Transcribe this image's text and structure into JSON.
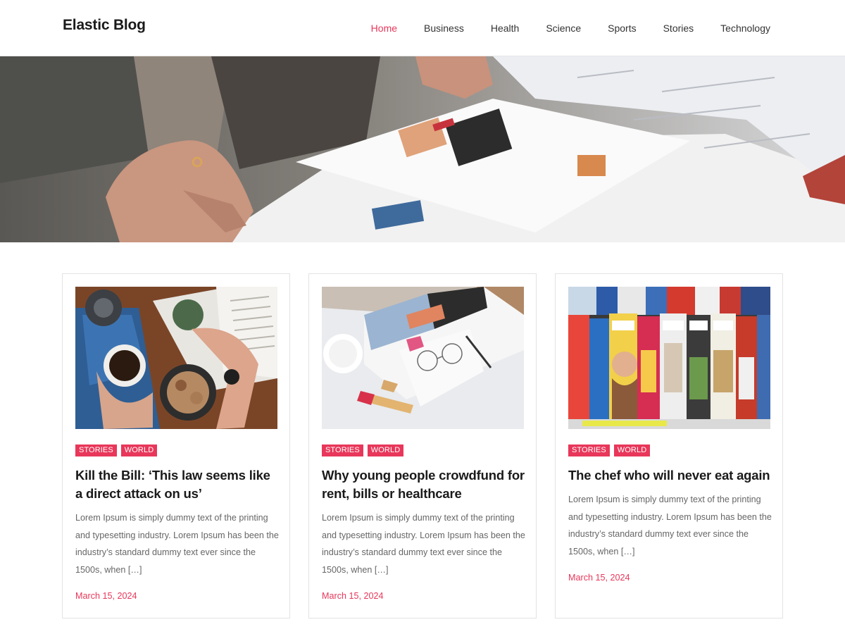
{
  "site": {
    "title": "Elastic Blog"
  },
  "nav": {
    "items": [
      {
        "label": "Home",
        "active": true
      },
      {
        "label": "Business"
      },
      {
        "label": "Health"
      },
      {
        "label": "Science"
      },
      {
        "label": "Sports"
      },
      {
        "label": "Stories"
      },
      {
        "label": "Technology"
      }
    ]
  },
  "hero": {
    "image": "hands-reading-magazine"
  },
  "posts": [
    {
      "image": "coffee-and-magazine-on-table",
      "categories": [
        "Stories",
        "World"
      ],
      "title": "Kill the Bill: ‘This law seems like a direct attack on us’",
      "excerpt": "Lorem Ipsum is simply dummy text of the printing and typesetting industry. Lorem Ipsum has been the industry’s standard dummy text ever since the 1500s, when […]",
      "date": "March 15, 2024"
    },
    {
      "image": "magazines-lipstick-glasses",
      "categories": [
        "Stories",
        "World"
      ],
      "title": "Why young people crowdfund for rent, bills or healthcare",
      "excerpt": "Lorem Ipsum is simply dummy text of the printing and typesetting industry. Lorem Ipsum has been the industry’s standard dummy text ever since the 1500s, when […]",
      "date": "March 15, 2024"
    },
    {
      "image": "magazine-rack",
      "categories": [
        "Stories",
        "World"
      ],
      "title": "The chef who will never eat again",
      "excerpt": "Lorem Ipsum is simply dummy text of the printing and typesetting industry. Lorem Ipsum has been the industry’s standard dummy text ever since the 1500s, when […]",
      "date": "March 15, 2024"
    }
  ],
  "colors": {
    "accent": "#e8375a",
    "text": "#1a1a1a",
    "muted": "#666666",
    "border": "#e3e3e3"
  }
}
